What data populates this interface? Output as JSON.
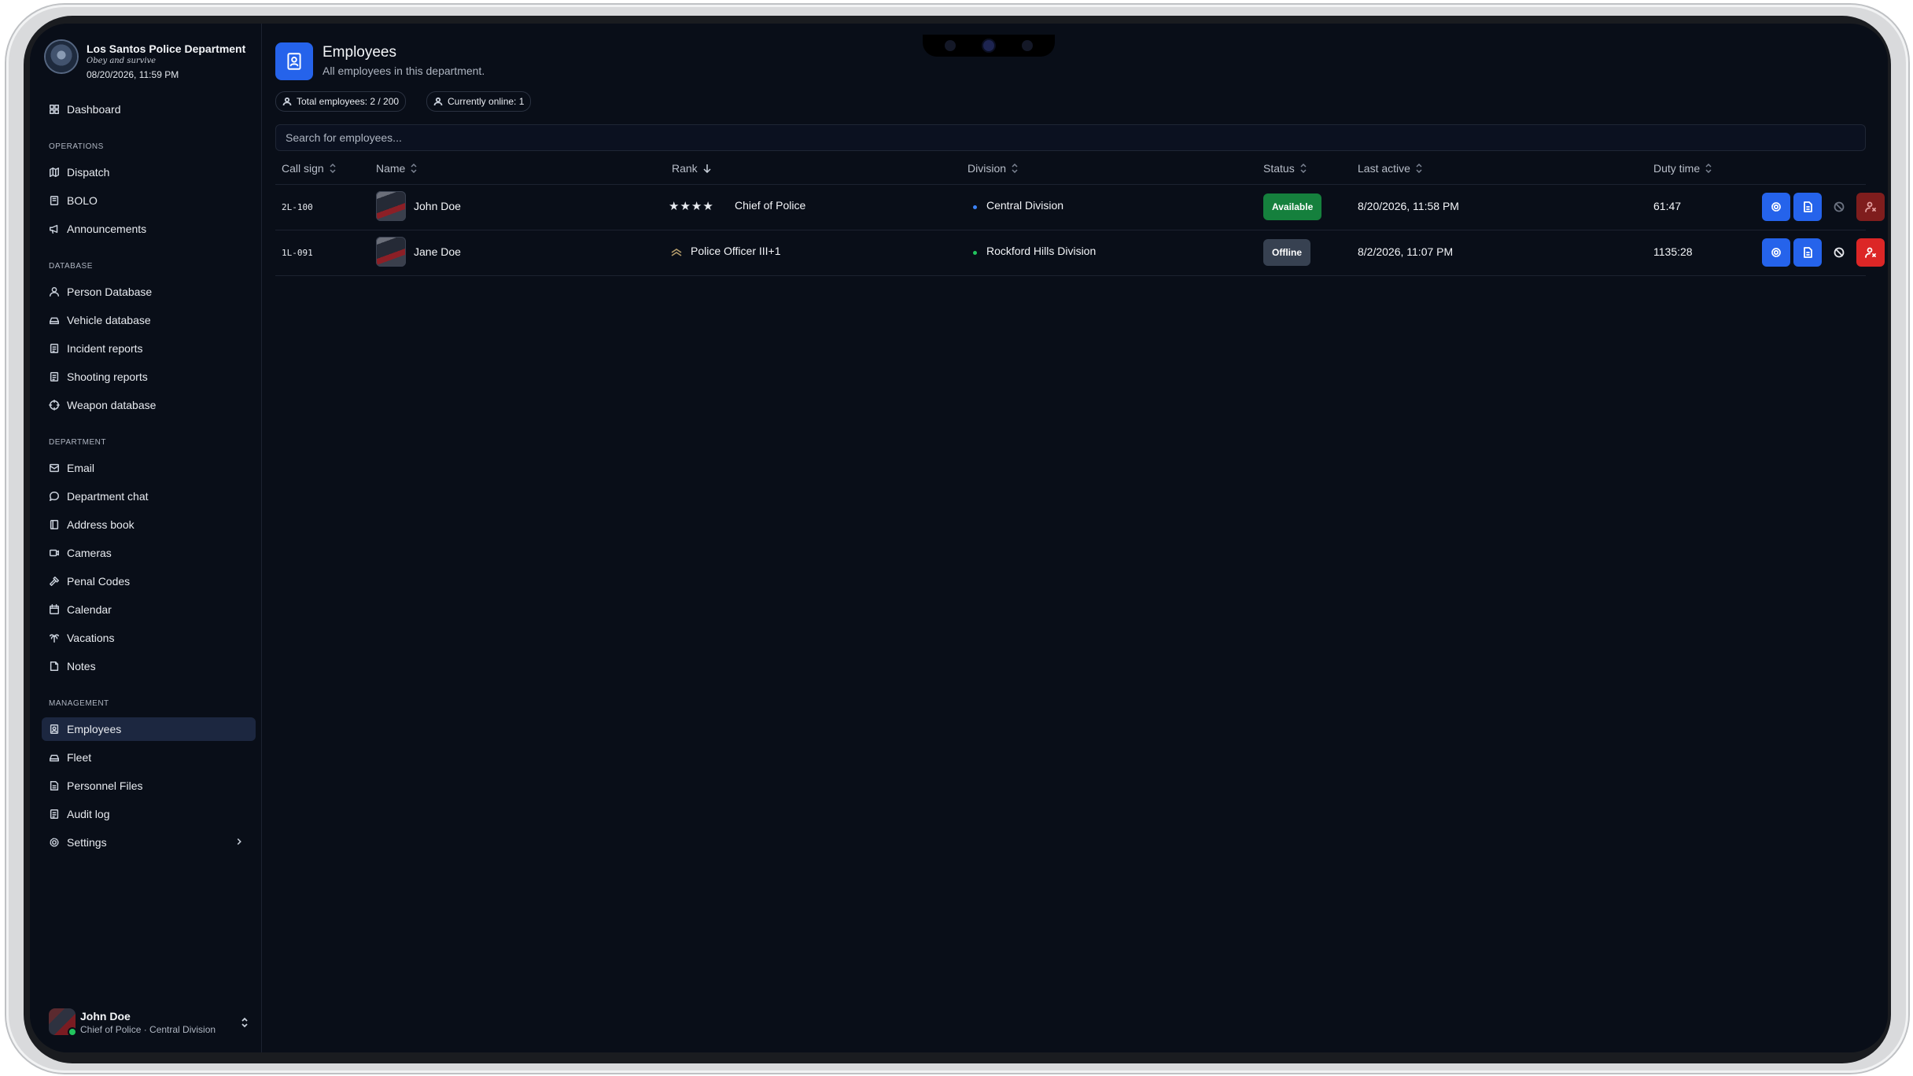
{
  "brand": {
    "name": "Los Santos Police Department",
    "motto": "Obey and survive",
    "datetime": "08/20/2026, 11:59 PM"
  },
  "sidebar": {
    "top": [
      {
        "label": "Dashboard",
        "icon": "dashboard-icon"
      }
    ],
    "sections": [
      {
        "title": "OPERATIONS",
        "items": [
          {
            "label": "Dispatch",
            "icon": "map-icon"
          },
          {
            "label": "BOLO",
            "icon": "book-icon"
          },
          {
            "label": "Announcements",
            "icon": "megaphone-icon"
          }
        ]
      },
      {
        "title": "DATABASE",
        "items": [
          {
            "label": "Person Database",
            "icon": "user-icon"
          },
          {
            "label": "Vehicle database",
            "icon": "car-icon"
          },
          {
            "label": "Incident reports",
            "icon": "clipboard-icon"
          },
          {
            "label": "Shooting reports",
            "icon": "clipboard-icon"
          },
          {
            "label": "Weapon database",
            "icon": "crosshair-icon"
          }
        ]
      },
      {
        "title": "DEPARTMENT",
        "items": [
          {
            "label": "Email",
            "icon": "mail-icon"
          },
          {
            "label": "Department chat",
            "icon": "chat-icon"
          },
          {
            "label": "Address book",
            "icon": "contacts-icon"
          },
          {
            "label": "Cameras",
            "icon": "video-icon"
          },
          {
            "label": "Penal Codes",
            "icon": "gavel-icon"
          },
          {
            "label": "Calendar",
            "icon": "calendar-icon"
          },
          {
            "label": "Vacations",
            "icon": "palm-icon"
          },
          {
            "label": "Notes",
            "icon": "note-icon"
          }
        ]
      },
      {
        "title": "MANAGEMENT",
        "items": [
          {
            "label": "Employees",
            "icon": "id-badge-icon",
            "active": true
          },
          {
            "label": "Fleet",
            "icon": "car-icon"
          },
          {
            "label": "Personnel Files",
            "icon": "file-icon"
          },
          {
            "label": "Audit log",
            "icon": "clipboard-icon"
          },
          {
            "label": "Settings",
            "icon": "gear-icon"
          }
        ]
      }
    ]
  },
  "user": {
    "name": "John Doe",
    "subtitle": "Chief of Police · Central Division"
  },
  "page": {
    "title": "Employees",
    "subtitle": "All employees in this department.",
    "total_label": "Total employees: 2 / 200",
    "online_label": "Currently online: 1",
    "search_placeholder": "Search for employees..."
  },
  "table": {
    "columns": [
      "Call sign",
      "Name",
      "Rank",
      "Division",
      "Status",
      "Last active",
      "Duty time"
    ],
    "sorted_by": "Rank",
    "rows": [
      {
        "callsign": "2L-100",
        "name": "John Doe",
        "rank_icon": "★★★★",
        "rank": "Chief of Police",
        "division": "Central Division",
        "division_color": "#3b82f6",
        "status": "Available",
        "status_color": "#15803d",
        "last_active": "8/20/2026, 11:58 PM",
        "duty_time": "61:47"
      },
      {
        "callsign": "1L-091",
        "name": "Jane Doe",
        "rank_icon": "chevron-rank-icon",
        "rank": "Police Officer III+1",
        "division": "Rockford Hills Division",
        "division_color": "#22c55e",
        "status": "Offline",
        "status_color": "#374151",
        "last_active": "8/2/2026, 11:07 PM",
        "duty_time": "1135:28"
      }
    ]
  },
  "colors": {
    "background": "#090e18",
    "accent": "#2563eb",
    "danger": "#dc2626",
    "danger_muted": "#7f1d1d"
  }
}
